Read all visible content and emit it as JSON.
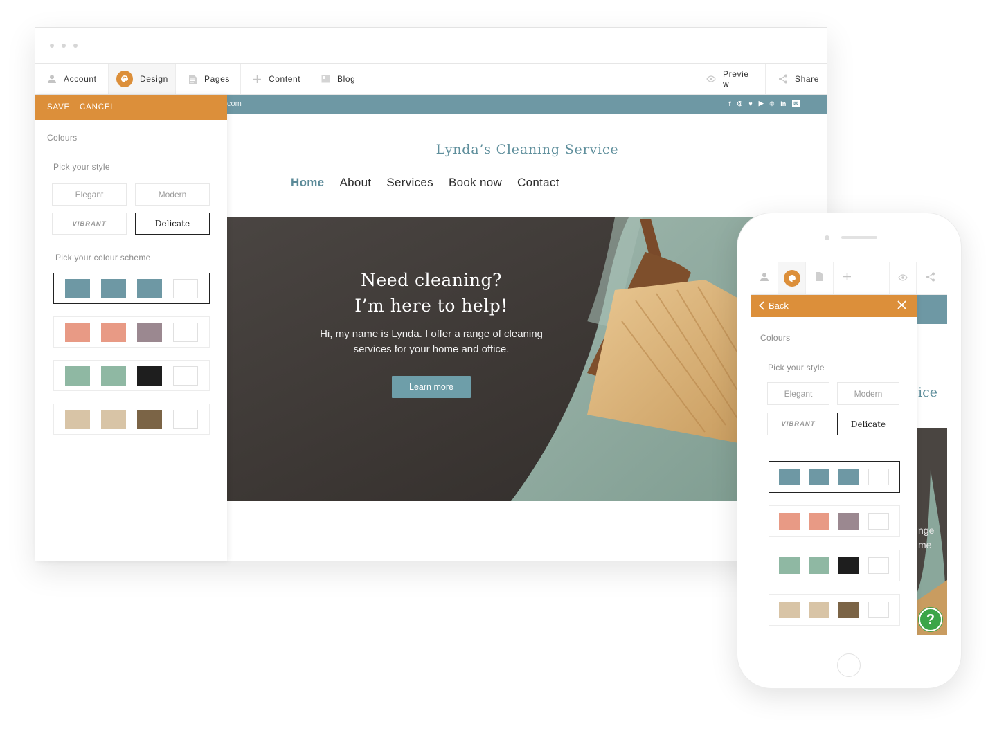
{
  "toolbar": {
    "account": "Account",
    "design": "Design",
    "pages": "Pages",
    "content": "Content",
    "blog": "Blog",
    "preview": "Preview",
    "share": "Share"
  },
  "panel": {
    "save": "SAVE",
    "cancel": "CANCEL",
    "colours": "Colours",
    "pick_style": "Pick your style",
    "styles": [
      "Elegant",
      "Modern",
      "VIBRANT",
      "Delicate"
    ],
    "selected_style": "Delicate",
    "pick_scheme": "Pick your colour scheme",
    "schemes": [
      [
        "#6e98a4",
        "#6e98a4",
        "#6e98a4",
        "#ffffff"
      ],
      [
        "#e89a85",
        "#e89a85",
        "#9b8890",
        "#ffffff"
      ],
      [
        "#8fb8a3",
        "#8fb8a3",
        "#1e1e1e",
        "#ffffff"
      ],
      [
        "#d8c4a6",
        "#d8c4a6",
        "#7b6446",
        "#ffffff"
      ]
    ],
    "selected_scheme": 0
  },
  "site": {
    "domain_fragment": "com",
    "social": [
      "f",
      "◎",
      "♥",
      "▶",
      "℗",
      "in",
      "✉"
    ],
    "brand": "Lynda’s Cleaning Service",
    "nav": [
      "Home",
      "About",
      "Services",
      "Book now",
      "Contact"
    ],
    "hero_title_line1": "Need cleaning?",
    "hero_title_line2": "I’m here to help!",
    "hero_text_line1": "Hi, my name is Lynda. I offer a range of cleaning",
    "hero_text_line2": "services for your home and office.",
    "hero_button": "Learn more"
  },
  "phone": {
    "back": "Back",
    "colours": "Colours",
    "pick_style": "Pick your style",
    "styles": [
      "Elegant",
      "Modern",
      "VIBRANT",
      "Delicate"
    ],
    "brand_fragment": "ice",
    "hero_fragment_line1": "nge",
    "hero_fragment_line2": "me",
    "help": "?"
  },
  "colors": {
    "accent_orange": "#dc8f3a",
    "brand_teal": "#6e98a4",
    "help_green": "#3aa548"
  }
}
